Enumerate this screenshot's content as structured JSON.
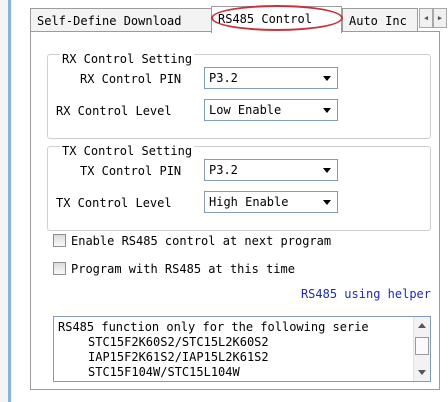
{
  "tabs": [
    "Self-Define Download",
    "RS485 Control",
    "Auto Inc"
  ],
  "rx": {
    "title": "RX Control Setting",
    "pin_label": "RX Control PIN",
    "pin_value": "P3.2",
    "level_label": "RX Control Level",
    "level_value": "Low Enable"
  },
  "tx": {
    "title": "TX Control Setting",
    "pin_label": "TX Control PIN",
    "pin_value": "P3.2",
    "level_label": "TX Control Level",
    "level_value": "High Enable"
  },
  "options": {
    "enable_next": "Enable RS485 control at next program",
    "program_now": "Program with RS485 at this time"
  },
  "helper_link": "RS485 using helper",
  "info": {
    "line1": "RS485 function only for the following serie",
    "line2": "STC15F2K60S2/STC15L2K60S2",
    "line3": "IAP15F2K61S2/IAP15L2K61S2",
    "line4": "STC15F104W/STC15L104W"
  },
  "colors": {
    "highlight_circle": "#c8323c",
    "link": "#1f2bb5"
  }
}
